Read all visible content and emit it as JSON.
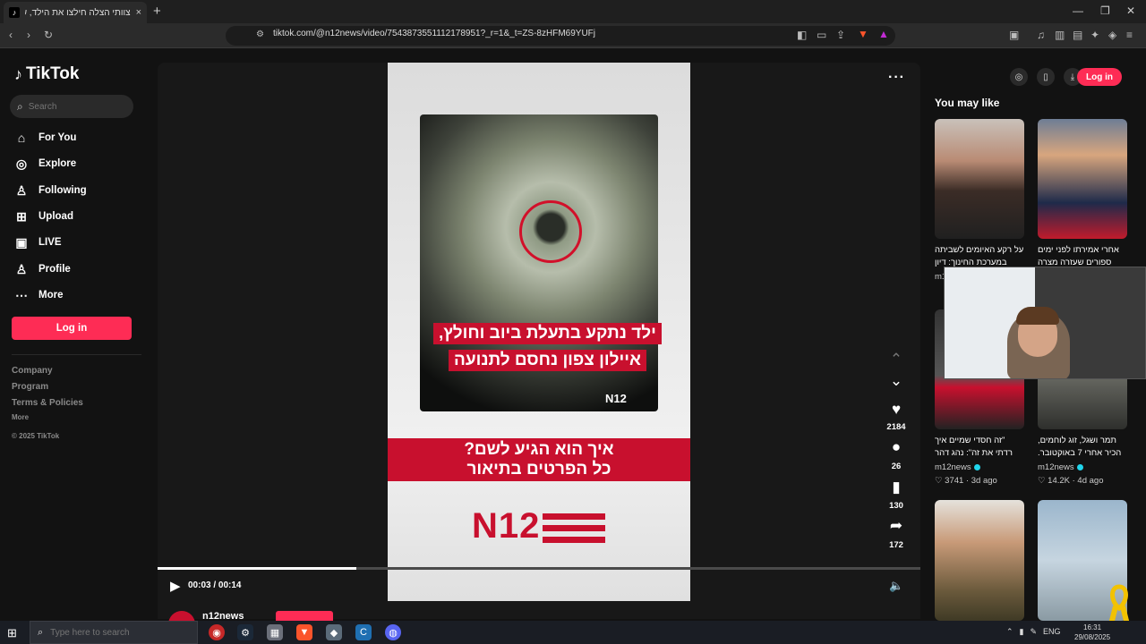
{
  "browser": {
    "tab_title": "צוותי הצלה חילצו את הילד, שנת",
    "tab_close": "×",
    "new_tab": "+",
    "url": "tiktok.com/@n12news/video/7543873551112178951?_r=1&_t=ZS-8zHFM69YUFj",
    "window_controls": [
      "—",
      "❐",
      "✕"
    ]
  },
  "sidebar": {
    "logo_text": "TikTok",
    "search_placeholder": "Search",
    "nav": [
      {
        "label": "For You",
        "icon": "home-icon"
      },
      {
        "label": "Explore",
        "icon": "compass-icon"
      },
      {
        "label": "Following",
        "icon": "following-icon"
      },
      {
        "label": "Upload",
        "icon": "upload-icon"
      },
      {
        "label": "LIVE",
        "icon": "live-icon"
      },
      {
        "label": "Profile",
        "icon": "profile-icon"
      },
      {
        "label": "More",
        "icon": "more-icon"
      }
    ],
    "login_label": "Log in",
    "footer": {
      "company": "Company",
      "program": "Program",
      "terms": "Terms & Policies",
      "more": "More",
      "copyright": "© 2025 TikTok"
    }
  },
  "video": {
    "overlay_line1": "ילד נתקע בתעלת ביוב וחולץ,",
    "overlay_line2": "איילון צפון נחסם לתנועה",
    "n12_small": "N12",
    "band_line1": "איך הוא הגיע לשם?",
    "band_line2": "כל הפרטים בתיאור",
    "n12_big": "N12",
    "time": "00:03 / 00:14",
    "progress": 0.26,
    "author": "n12news",
    "actions": {
      "likes": "2184",
      "comments": "26",
      "saves": "130",
      "shares": "172"
    }
  },
  "right": {
    "login_label": "Log in",
    "title": "You may like",
    "cards": [
      {
        "caption": "על רקע האיומים לשביתה במערכת החינוך: דיון",
        "author": "m1",
        "meta": ""
      },
      {
        "caption": "אחרי אמירתו לפני ימים ספורים שעזרה מצרה",
        "author": "",
        "meta": ""
      },
      {
        "caption": "\"זה חסדי שמיים איך רדתי את זה\": נהג דהר",
        "author": "m12news",
        "meta": "3741 · 3d ago"
      },
      {
        "caption": "תמר ושגל, זוג לוחמים, הכיר אחרי 7 באוקטובר.",
        "author": "m12news",
        "meta": "14.2K · 4d ago"
      },
      {
        "caption": "",
        "author": "",
        "meta": ""
      },
      {
        "caption": "",
        "author": "",
        "meta": ""
      }
    ]
  },
  "taskbar": {
    "search_placeholder": "Type here to search",
    "lang": "ENG",
    "time": "16:31",
    "date": "29/08/2025"
  },
  "colors": {
    "accent": "#fe2c55",
    "n12_red": "#c8102e",
    "background": "#121212"
  }
}
